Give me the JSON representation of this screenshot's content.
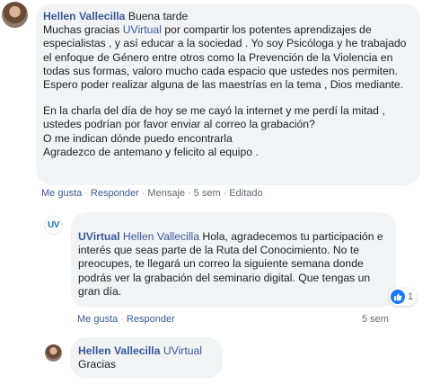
{
  "comments": [
    {
      "author": "Hellen Vallecilla",
      "text_a": " Buena tarde",
      "text_b": "Muchas gracias ",
      "mention": "UVirtual",
      "text_c": " por compartir los potentes aprendizajes de especialistas , y así educar a la sociedad . Yo soy Psicóloga y he trabajado el enfoque de Género entre otros como la Prevención de la Violencia en todas sus formas, valoro mucho cada espacio que ustedes nos permiten. Espero poder realizar alguna de las maestrías en la tema , Dios mediante.",
      "para2_line1": "En la charla del día de hoy se me cayó la internet y me perdí la mitad , ustedes podrían por favor enviar al correo la grabación?",
      "para2_line2": "O me indican dónde puedo encontrarla",
      "para2_line3": "Agradezco de antemano y felicito al equipo .",
      "actions": {
        "like": "Me gusta",
        "reply": "Responder",
        "message": "Mensaje",
        "time": "5 sem",
        "edited": "Editado"
      }
    }
  ],
  "reply": {
    "avatar_text": "UV",
    "author": "UVirtual",
    "mention": "Hellen Vallecilla",
    "text": " Hola, agradecemos tu participación e interés que seas parte de la Ruta del Conocimiento. No te preocupes, te llegará un correo la siguiente semana donde podrás ver la grabación del seminario digital. Que tengas un gran día.",
    "reaction_count": "1",
    "actions": {
      "like": "Me gusta",
      "reply": "Responder",
      "time": "5 sem"
    }
  },
  "nested_reply": {
    "author": "Hellen Vallecilla",
    "mention": "UVirtual",
    "text": "Gracias"
  },
  "colors": {
    "link": "#385898",
    "bubble": "#f2f3f5",
    "like_blue": "#1877f2"
  }
}
